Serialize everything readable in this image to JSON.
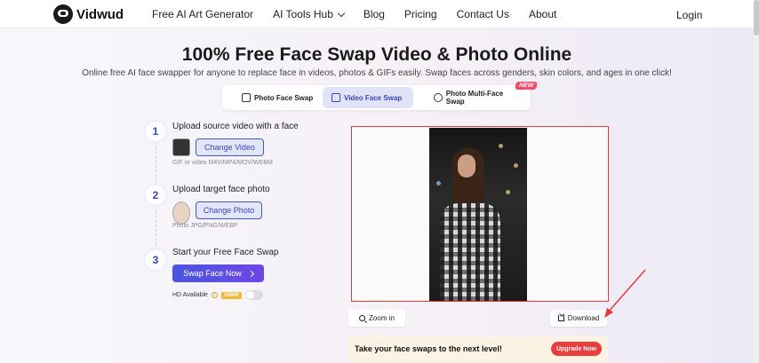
{
  "header": {
    "brand": "Vidwud",
    "menu": [
      "Free AI Art Generator",
      "AI Tools Hub",
      "Blog",
      "Pricing",
      "Contact Us",
      "About"
    ],
    "login": "Login"
  },
  "hero": {
    "title": "100% Free Face Swap Video & Photo Online",
    "subtitle": "Online free AI face swapper for anyone to replace face in videos, photos & GIFs easily. Swap faces across genders, skin colors, and ages in one click!"
  },
  "tabs": [
    {
      "label": "Photo Face Swap",
      "icon": "image-icon"
    },
    {
      "label": "Video Face Swap",
      "icon": "video-icon"
    },
    {
      "label": "Photo Multi-Face Swap",
      "icon": "multi-face-icon"
    }
  ],
  "new_badge": "NEW",
  "steps": {
    "step1": {
      "num": "1",
      "title": "Upload source video with a face",
      "button": "Change Video",
      "hint": "GIF or video M4V/MP4/MOV/WEBM"
    },
    "step2": {
      "num": "2",
      "title": "Upload target face photo",
      "button": "Change Photo",
      "hint": "Photo JPG/PNG/WEBP"
    },
    "step3": {
      "num": "3",
      "title": "Start your Free Face Swap",
      "button": "Swap Face Now"
    }
  },
  "hd": {
    "label": "HD Available",
    "tag": "1080P"
  },
  "preview": {
    "zoom_label": "Zoom in",
    "download_label": "Download"
  },
  "promo": {
    "text": "Take your face swaps to the next level!",
    "button": "Upgrade Now"
  },
  "colors": {
    "accent": "#4654c8",
    "highlight_box": "#e23b3b",
    "upgrade": "#ea3d3d",
    "new_badge": "#f24d6b"
  }
}
